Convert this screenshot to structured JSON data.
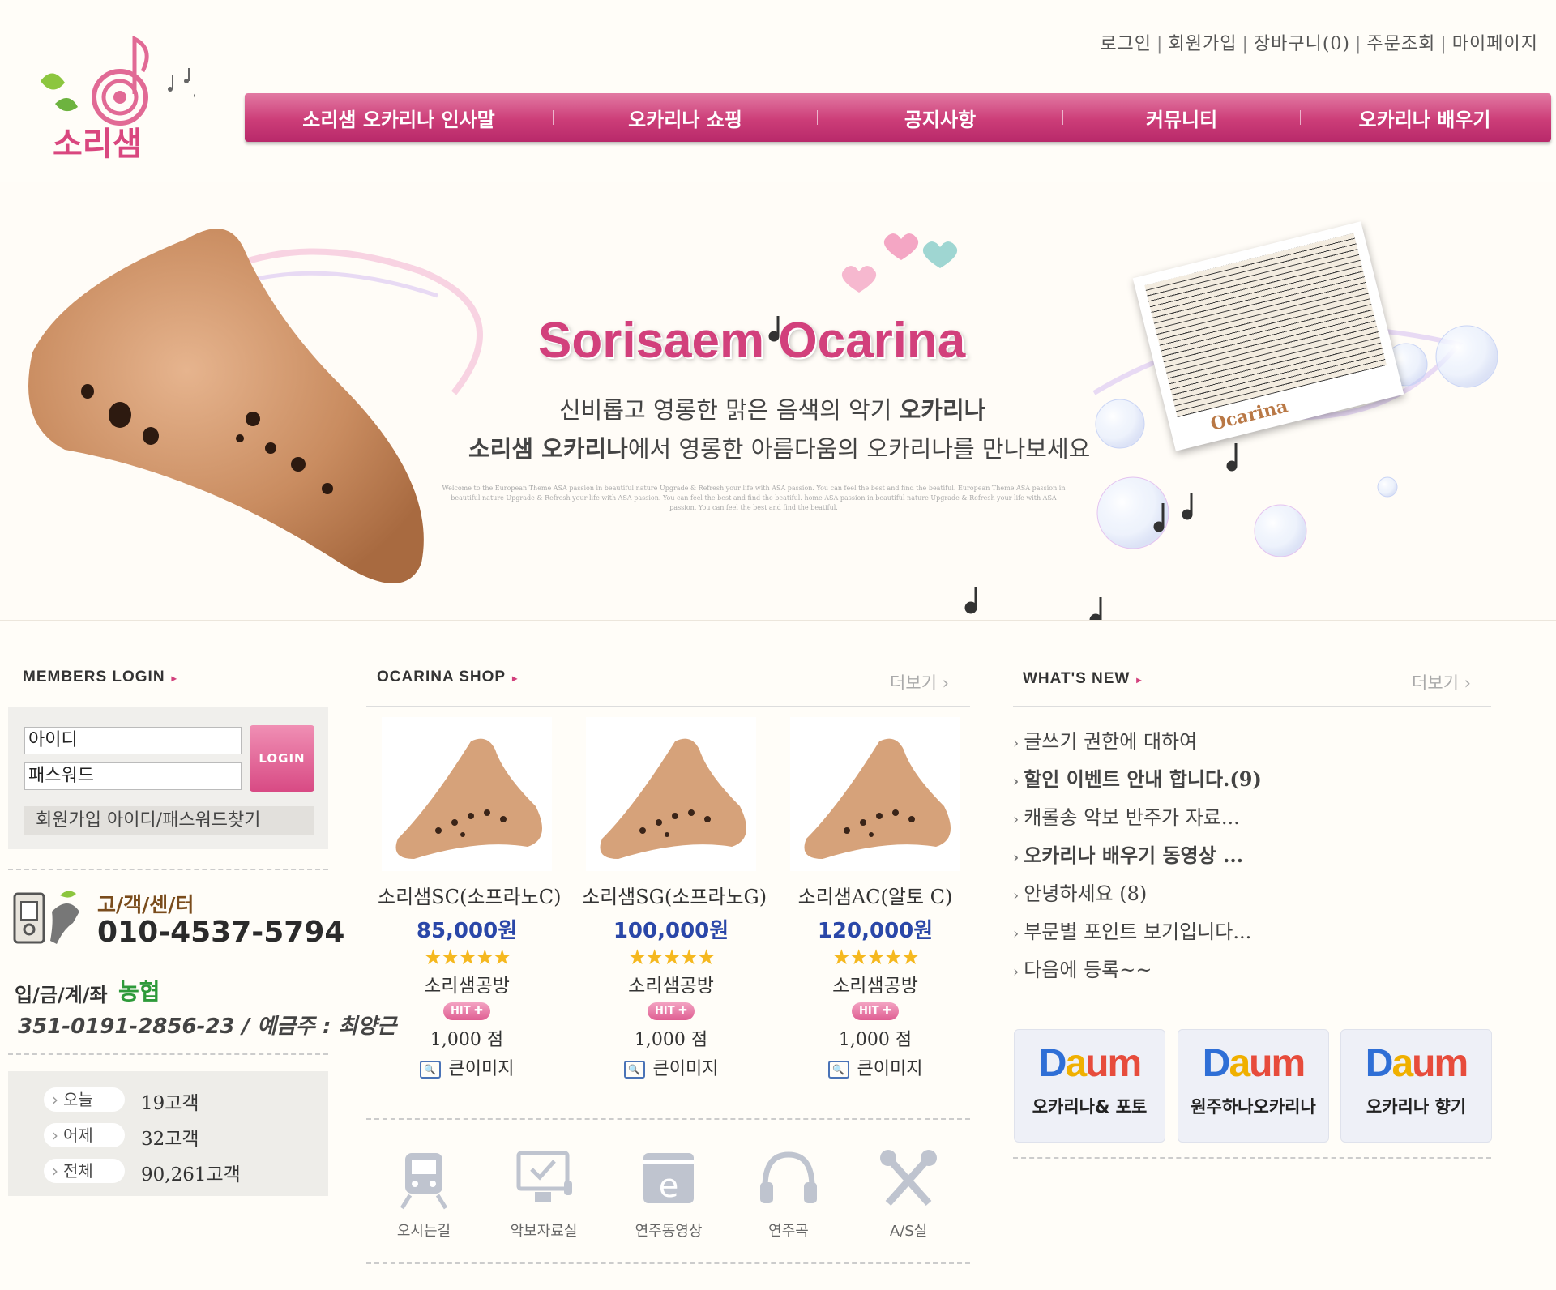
{
  "top_links": [
    "로그인",
    "회원가입",
    "장바구니(0)",
    "주문조회",
    "마이페이지"
  ],
  "logo": {
    "text": "소리샘"
  },
  "nav": [
    "소리샘 오카리나 인사말",
    "오카리나 쇼핑",
    "공지사항",
    "커뮤니티",
    "오카리나 배우기"
  ],
  "banner": {
    "title": "Sorisaem Ocarina",
    "sub1_pre": "신비롭고 영롱한 맑은 음색의 악기 ",
    "sub1_bold": "오카리나",
    "sub2_bold": "소리샘 오카리나",
    "sub2_post": "에서 영롱한 아름다움의 오카리나를 만나보세요",
    "small_text": "Welcome to the European Theme ASA passion in beautiful nature Upgrade & Refresh your life with ASA passion. You can feel the best and find the beatiful. European Theme ASA passion in beautiful nature Upgrade & Refresh your life with ASA passion. You can feel the best and find the beatiful. home ASA passion in beautiful nature Upgrade & Refresh your life with ASA passion. You can feel the best and find the beatiful.",
    "photo_caption": "Ocarina"
  },
  "login": {
    "header": "MEMBERS LOGIN",
    "id_value": "아이디",
    "pw_value": "패스워드",
    "button": "LOGIN",
    "join": "회원가입 아이디/패스워드찾기"
  },
  "customer_center": {
    "title": "고/객/센/터",
    "phone": "010-4537-5794",
    "bank_label": "입/금/계/좌",
    "bank_name": "농협",
    "account": "351-0191-2856-23 / 예금주 : 최양근"
  },
  "stats": [
    {
      "label": "오늘",
      "value": "19고객"
    },
    {
      "label": "어제",
      "value": "32고객"
    },
    {
      "label": "전체",
      "value": "90,261고객"
    }
  ],
  "shop": {
    "header": "OCARINA SHOP",
    "more": "더보기",
    "products": [
      {
        "name": "소리샘SC(소프라노C)",
        "price": "85,000원",
        "maker": "소리샘공방",
        "badge": "HIT",
        "point": "1,000 점",
        "zoom": "큰이미지"
      },
      {
        "name": "소리샘SG(소프라노G)",
        "price": "100,000원",
        "maker": "소리샘공방",
        "badge": "HIT",
        "point": "1,000 점",
        "zoom": "큰이미지"
      },
      {
        "name": "소리샘AC(알토 C)",
        "price": "120,000원",
        "maker": "소리샘공방",
        "badge": "HIT",
        "point": "1,000 점",
        "zoom": "큰이미지"
      }
    ],
    "rating_stars": 5
  },
  "quick_icons": [
    "오시는길",
    "악보자료실",
    "연주동영상",
    "연주곡",
    "A/S실"
  ],
  "news": {
    "header": "WHAT'S NEW",
    "more": "더보기",
    "items": [
      {
        "text": "글쓰기 권한에 대하여"
      },
      {
        "text": "할인 이벤트 안내 합니다.(9)"
      },
      {
        "text": "캐롤송 악보 반주가 자료..."
      },
      {
        "text": "오카리나 배우기 동영상 ..."
      },
      {
        "text": "안녕하세요 (8)"
      },
      {
        "text": "부문별 포인트 보기입니다..."
      },
      {
        "text": "다음에 등록~~"
      }
    ]
  },
  "daum_cafes": [
    {
      "logo": "Daum",
      "name": "오카리나& 포토"
    },
    {
      "logo": "Daum",
      "name": "원주하나오카리나"
    },
    {
      "logo": "Daum",
      "name": "오카리나 향기"
    }
  ],
  "colors": {
    "accent": "#d2407c",
    "price": "#2a47a8",
    "bank": "#2e9a3a"
  }
}
